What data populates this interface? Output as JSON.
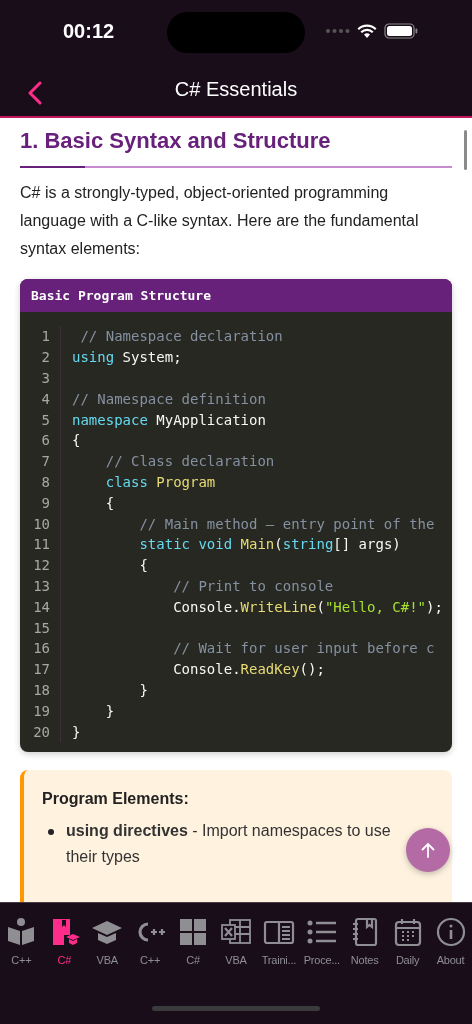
{
  "status_bar": {
    "time": "00:12"
  },
  "nav": {
    "title": "C# Essentials"
  },
  "section": {
    "heading": "1. Basic Syntax and Structure",
    "intro": "C# is a strongly-typed, object-oriented programming language with a C-like syntax. Here are the fundamental syntax elements:"
  },
  "code_block": {
    "title": "Basic Program Structure",
    "lines": [
      {
        "number": "1",
        "tokens": [
          {
            "text": " // Namespace declaration",
            "kind": "comment"
          }
        ]
      },
      {
        "number": "2",
        "tokens": [
          {
            "text": "using",
            "kind": "keyword"
          },
          {
            "text": " System;",
            "kind": "plain"
          }
        ]
      },
      {
        "number": "3"
      },
      {
        "number": "4",
        "tokens": [
          {
            "text": "// Namespace definition",
            "kind": "comment"
          }
        ]
      },
      {
        "number": "5",
        "tokens": [
          {
            "text": "namespace",
            "kind": "keyword"
          },
          {
            "text": " MyApplication",
            "kind": "plain"
          }
        ]
      },
      {
        "number": "6",
        "tokens": [
          {
            "text": "{",
            "kind": "plain"
          }
        ]
      },
      {
        "number": "7",
        "tokens": [
          {
            "text": "    // Class declaration",
            "kind": "comment"
          }
        ]
      },
      {
        "number": "8",
        "tokens": [
          {
            "text": "    class",
            "kind": "keyword"
          },
          {
            "text": " Program",
            "kind": "type"
          }
        ]
      },
      {
        "number": "9",
        "tokens": [
          {
            "text": "    {",
            "kind": "plain"
          }
        ]
      },
      {
        "number": "10",
        "tokens": [
          {
            "text": "        // Main method – entry point of the",
            "kind": "comment"
          }
        ]
      },
      {
        "number": "11",
        "tokens": [
          {
            "text": "        static void",
            "kind": "keyword"
          },
          {
            "text": " Main",
            "kind": "type"
          },
          {
            "text": "(",
            "kind": "plain"
          },
          {
            "text": "string",
            "kind": "keyword"
          },
          {
            "text": "[] args)",
            "kind": "plain"
          }
        ]
      },
      {
        "number": "12",
        "tokens": [
          {
            "text": "        {",
            "kind": "plain"
          }
        ]
      },
      {
        "number": "13",
        "tokens": [
          {
            "text": "            // Print to console",
            "kind": "comment"
          }
        ]
      },
      {
        "number": "14",
        "tokens": [
          {
            "text": "            Console.",
            "kind": "plain"
          },
          {
            "text": "WriteLine",
            "kind": "type"
          },
          {
            "text": "(",
            "kind": "plain"
          },
          {
            "text": "\"Hello, C#!\"",
            "kind": "string"
          },
          {
            "text": ");",
            "kind": "plain"
          }
        ]
      },
      {
        "number": "15"
      },
      {
        "number": "16",
        "tokens": [
          {
            "text": "            // Wait for user input before c",
            "kind": "comment"
          }
        ]
      },
      {
        "number": "17",
        "tokens": [
          {
            "text": "            Console.",
            "kind": "plain"
          },
          {
            "text": "ReadKey",
            "kind": "type"
          },
          {
            "text": "();",
            "kind": "plain"
          }
        ]
      },
      {
        "number": "18",
        "tokens": [
          {
            "text": "        }",
            "kind": "plain"
          }
        ]
      },
      {
        "number": "19",
        "tokens": [
          {
            "text": "    }",
            "kind": "plain"
          }
        ]
      },
      {
        "number": "20",
        "tokens": [
          {
            "text": "}",
            "kind": "plain"
          }
        ]
      }
    ]
  },
  "note": {
    "title": "Program Elements:",
    "items": [
      "**using directives** - Import namespaces to use their types"
    ]
  },
  "tab_bar": [
    {
      "label": "C++",
      "selected": false
    },
    {
      "label": "C#",
      "selected": true
    },
    {
      "label": "VBA",
      "selected": false
    },
    {
      "label": "C++",
      "selected": false
    },
    {
      "label": "C#",
      "selected": false
    },
    {
      "label": "VBA",
      "selected": false
    },
    {
      "label": "Traini...",
      "selected": false
    },
    {
      "label": "Proce...",
      "selected": false
    },
    {
      "label": "Notes",
      "selected": false
    },
    {
      "label": "Daily",
      "selected": false
    },
    {
      "label": "About",
      "selected": false
    }
  ]
}
